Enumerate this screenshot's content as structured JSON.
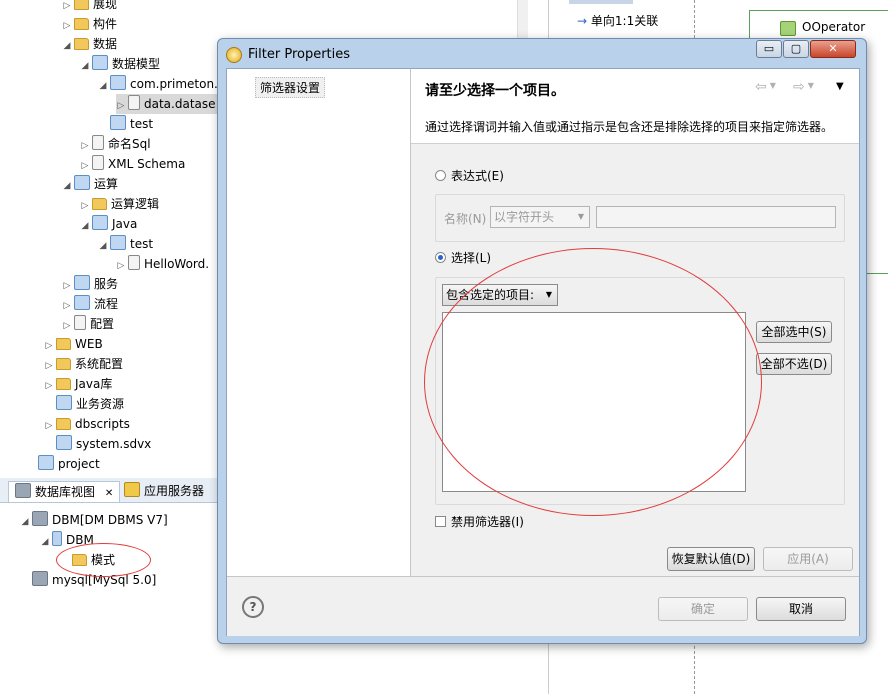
{
  "tree": {
    "items": [
      {
        "label": "展现",
        "twisty": "▷"
      },
      {
        "label": "构件",
        "twisty": "▷"
      },
      {
        "label": "数据",
        "twisty": "◢"
      },
      {
        "label": "数据模型",
        "twisty": "◢"
      },
      {
        "label": "com.primeton.",
        "twisty": "◢"
      },
      {
        "label": "data.datase",
        "twisty": "▷"
      },
      {
        "label": "test",
        "twisty": ""
      },
      {
        "label": "命名Sql",
        "twisty": "▷"
      },
      {
        "label": "XML Schema",
        "twisty": "▷"
      },
      {
        "label": "运算",
        "twisty": "◢"
      },
      {
        "label": "运算逻辑",
        "twisty": "▷"
      },
      {
        "label": "Java",
        "twisty": "◢"
      },
      {
        "label": "test",
        "twisty": "◢"
      },
      {
        "label": "HelloWord.",
        "twisty": "▷"
      },
      {
        "label": "服务",
        "twisty": "▷"
      },
      {
        "label": "流程",
        "twisty": "▷"
      },
      {
        "label": "配置",
        "twisty": "▷"
      },
      {
        "label": "WEB",
        "twisty": "▷"
      },
      {
        "label": "系统配置",
        "twisty": "▷"
      },
      {
        "label": "Java库",
        "twisty": "▷"
      },
      {
        "label": "业务资源",
        "twisty": ""
      },
      {
        "label": "dbscripts",
        "twisty": "▷"
      },
      {
        "label": "system.sdvx",
        "twisty": ""
      },
      {
        "label": "project",
        "twisty": ""
      }
    ]
  },
  "db_panel": {
    "tab_db": "数据库视图",
    "tab_db_close": "✕",
    "tab_app": "应用服务器",
    "items": [
      {
        "label": "DBM[DM DBMS V7]",
        "twisty": "◢"
      },
      {
        "label": "DBM",
        "twisty": "◢"
      },
      {
        "label": "模式",
        "twisty": ""
      },
      {
        "label": "mysql[MySql 5.0]",
        "twisty": ""
      }
    ]
  },
  "right_bg": {
    "tab_label": "单向1:1关联",
    "operator_label": "OOperator"
  },
  "dialog": {
    "title": "Filter Properties",
    "minimize": "▭",
    "maximize": "▢",
    "close": "✕",
    "nav_item": "筛选器设置",
    "heading": "请至少选择一个项目。",
    "description": "通过选择谓词并输入值或通过指示是包含还是排除选择的项目来指定筛选器。",
    "nav_back": "⇦",
    "nav_forward": "⇨",
    "nav_menu": "▼",
    "radio_expression": "表达式(E)",
    "name_label": "名称(N)",
    "name_combo": "以字符开头",
    "radio_select": "选择(L)",
    "include_combo": "包含选定的项目:",
    "select_all": "全部选中(S)",
    "deselect_all": "全部不选(D)",
    "disable_filter": "禁用筛选器(I)",
    "restore_defaults": "恢复默认值(D)",
    "apply": "应用(A)",
    "ok": "确定",
    "cancel": "取消",
    "help": "?"
  },
  "colors": {
    "annotation": "#e23b3b",
    "dialog_frame": "#b9d1ea",
    "radio_accent": "#2b63c9"
  }
}
